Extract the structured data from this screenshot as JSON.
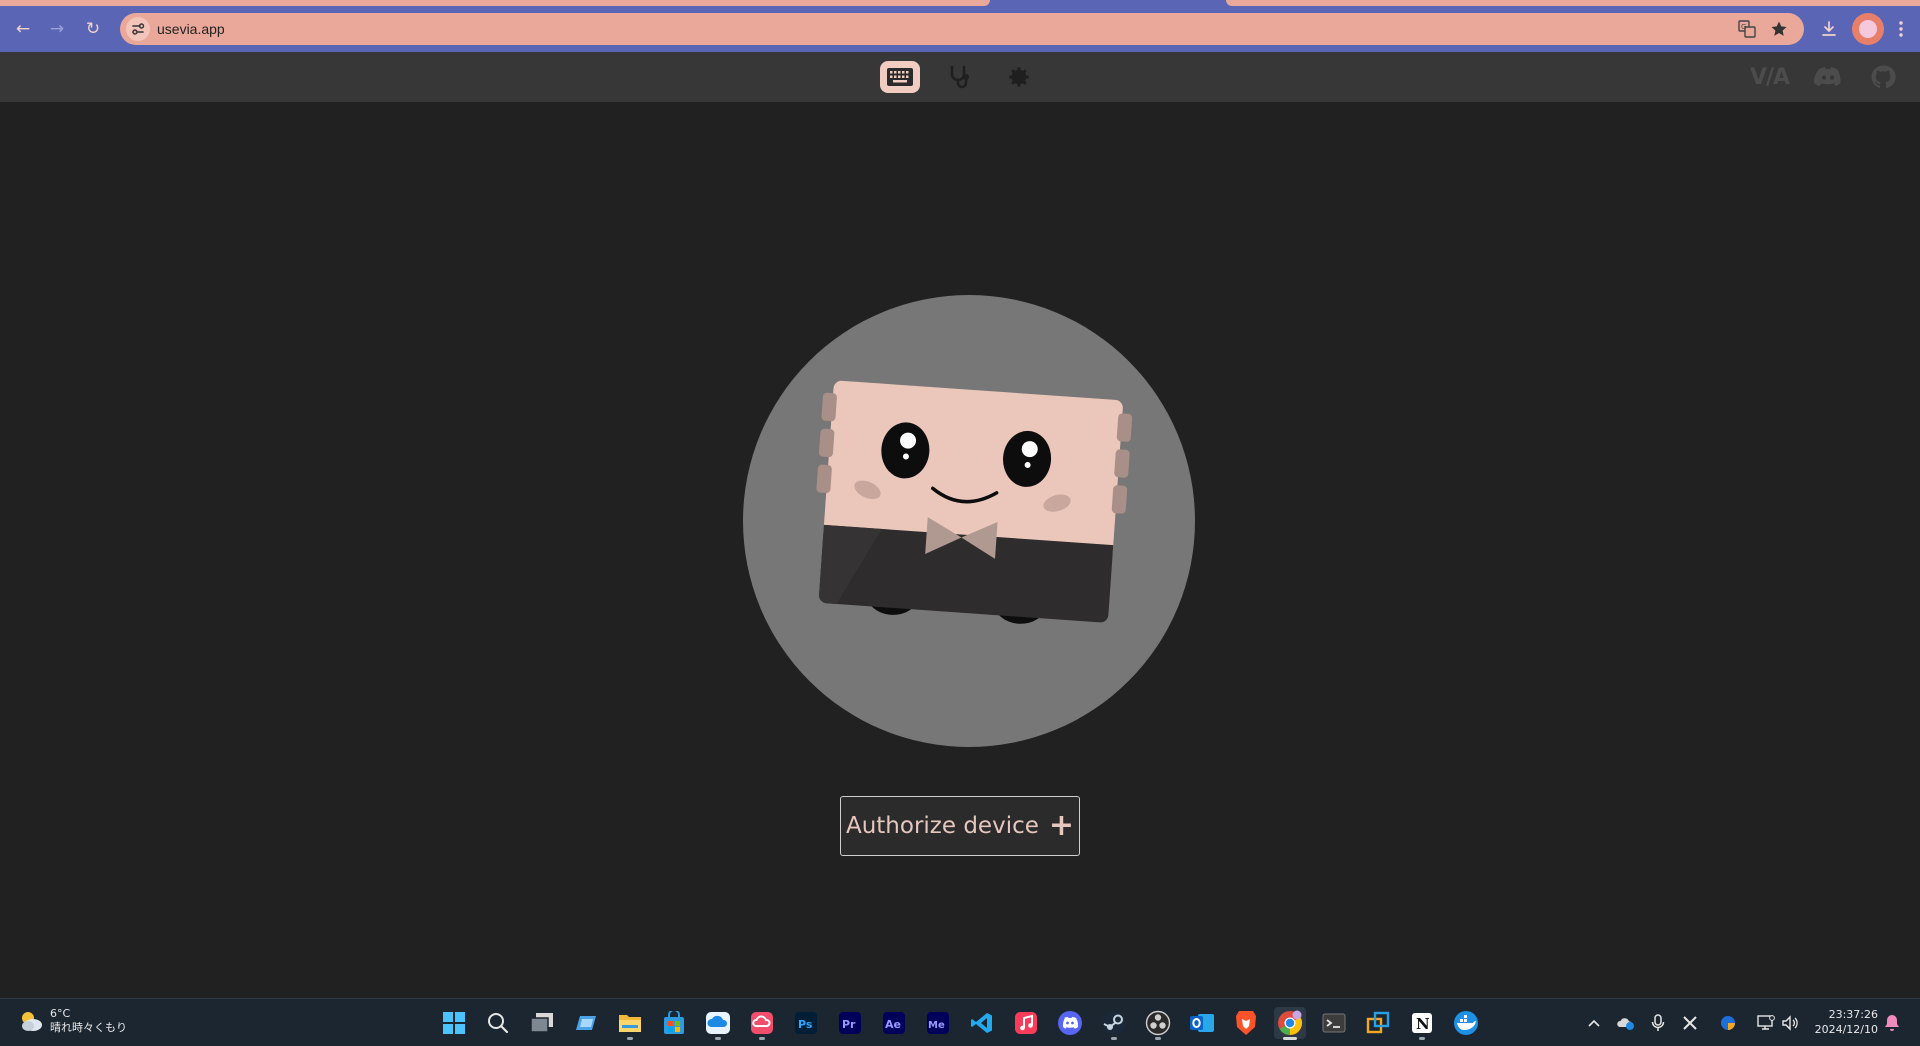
{
  "browser": {
    "url": "usevia.app",
    "back_label": "←",
    "forward_label": "→",
    "reload_label": "↻"
  },
  "app_header": {
    "tabs": [
      {
        "name": "configure",
        "icon": "keyboard-icon",
        "active": true
      },
      {
        "name": "test",
        "icon": "stethoscope-icon",
        "active": false
      },
      {
        "name": "settings",
        "icon": "gear-icon",
        "active": false
      }
    ],
    "logo": "V/A",
    "links": [
      "discord-icon",
      "github-icon"
    ]
  },
  "main": {
    "mascot": "keyboard-mascot",
    "authorize_label": "Authorize device",
    "authorize_icon": "+"
  },
  "taskbar": {
    "weather": {
      "temp": "6°C",
      "desc": "晴れ時々くもり"
    },
    "apps": [
      "windows-start-icon",
      "search-icon",
      "task-view-icon",
      "widgets-app-icon",
      "file-explorer-icon",
      "ms-store-icon",
      "onedrive-app-icon",
      "creative-cloud-icon",
      "photoshop-icon",
      "premiere-icon",
      "after-effects-icon",
      "media-encoder-icon",
      "vscode-icon",
      "apple-music-icon",
      "discord-icon",
      "steam-icon",
      "obs-icon",
      "outlook-icon",
      "brave-icon",
      "chrome-icon",
      "terminal-icon",
      "remote-icon",
      "notion-icon",
      "docker-icon"
    ],
    "app_labels": {
      "ps": "Ps",
      "pr": "Pr",
      "ae": "Ae",
      "me": "Me",
      "notion": "N"
    },
    "clock": {
      "time": "23:37:26",
      "date": "2024/12/10"
    }
  },
  "colors": {
    "chrome": "#5a65b5",
    "urlbar": "#e9a89a",
    "page_bg": "#212121",
    "header_bg": "#373737",
    "accent": "#f0ccc1",
    "taskbar": "#1c2630"
  }
}
